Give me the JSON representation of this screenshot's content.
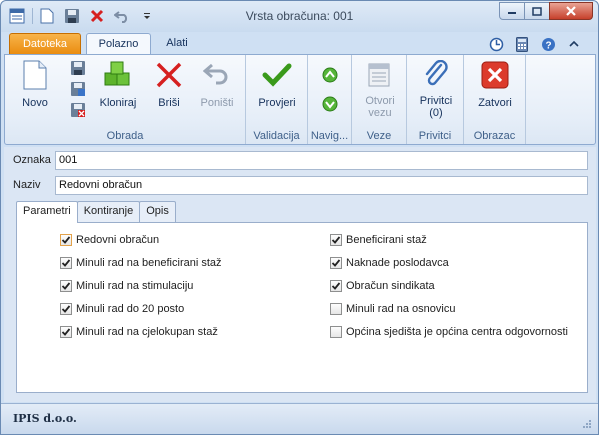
{
  "window": {
    "title": "Vrsta obračuna: 001"
  },
  "quick_access": {
    "icons": [
      "app-menu-icon",
      "new-icon",
      "save-icon",
      "delete-icon",
      "undo-icon",
      "customize-dropdown-icon"
    ]
  },
  "ribbon_tabs": {
    "file": "Datoteka",
    "home": "Polazno",
    "tools": "Alati"
  },
  "ribbon": {
    "groups": {
      "obrada": {
        "label": "Obrada",
        "novo": "Novo",
        "kloniraj": "Kloniraj",
        "brisi": "Briši",
        "ponisti": "Poništi"
      },
      "validacija": {
        "label": "Validacija",
        "provjeri": "Provjeri"
      },
      "navig": {
        "label": "Navig..."
      },
      "veze": {
        "label": "Veze",
        "otvori_line1": "Otvori",
        "otvori_line2": "vezu"
      },
      "privitci": {
        "label": "Privitci",
        "btn_line1": "Privitci",
        "btn_line2": "(0)"
      },
      "obrazac": {
        "label": "Obrazac",
        "zatvori": "Zatvori"
      }
    }
  },
  "form": {
    "oznaka_label": "Oznaka",
    "oznaka_value": "001",
    "naziv_label": "Naziv",
    "naziv_value": "Redovni obračun"
  },
  "detail_tabs": {
    "parametri": "Parametri",
    "kontiranje": "Kontiranje",
    "opis": "Opis"
  },
  "checkboxes": {
    "left": [
      {
        "label": "Redovni obračun",
        "checked": true
      },
      {
        "label": "Minuli rad na beneficirani staž",
        "checked": true
      },
      {
        "label": "Minuli rad na stimulaciju",
        "checked": true
      },
      {
        "label": "Minuli rad do 20 posto",
        "checked": true
      },
      {
        "label": "Minuli rad na cjelokupan staž",
        "checked": true
      }
    ],
    "right": [
      {
        "label": "Beneficirani staž",
        "checked": true
      },
      {
        "label": "Naknade poslodavca",
        "checked": true
      },
      {
        "label": "Obračun sindikata",
        "checked": true
      },
      {
        "label": "Minuli rad na osnovicu",
        "checked": false
      },
      {
        "label": "Općina sjedišta je općina centra odgovornosti",
        "checked": false
      }
    ]
  },
  "status_bar": {
    "company": "IPIS d.o.o."
  },
  "colors": {
    "file_tab": "#e98a0d",
    "check": "#222222",
    "delete": "#d62020",
    "accent_green": "#3a9a1b"
  }
}
